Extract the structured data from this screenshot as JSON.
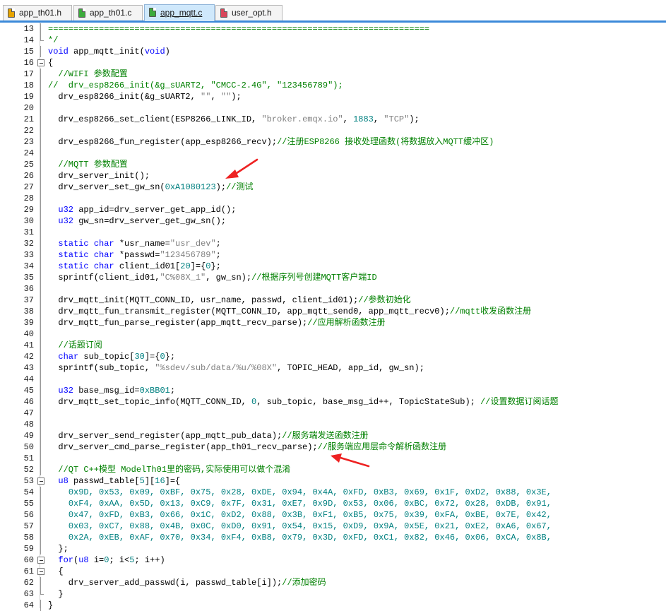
{
  "tabs": [
    {
      "label": "app_th01.h",
      "color": "#e6a400",
      "active": false
    },
    {
      "label": "app_th01.c",
      "color": "#3cab3c",
      "active": false
    },
    {
      "label": "app_mqtt.c",
      "color": "#3cab3c",
      "active": true
    },
    {
      "label": "user_opt.h",
      "color": "#d8465a",
      "active": false
    }
  ],
  "lines": [
    {
      "n": "13",
      "segs": [
        {
          "t": "===========================================================================",
          "c": "cm"
        }
      ]
    },
    {
      "n": "14",
      "segs": [
        {
          "t": "*/",
          "c": "cm"
        }
      ]
    },
    {
      "n": "15",
      "segs": [
        {
          "t": "void",
          "c": "kw"
        },
        {
          "t": " app_mqtt_init(",
          "c": ""
        },
        {
          "t": "void",
          "c": "kw"
        },
        {
          "t": ")",
          "c": ""
        }
      ]
    },
    {
      "n": "16",
      "segs": [
        {
          "t": "{",
          "c": ""
        }
      ]
    },
    {
      "n": "17",
      "segs": [
        {
          "t": "  //WIFI 参数配置",
          "c": "cm"
        }
      ]
    },
    {
      "n": "18",
      "segs": [
        {
          "t": "//  drv_esp8266_init(&g_sUART2, \"CMCC-2.4G\", \"123456789\");",
          "c": "cm"
        }
      ]
    },
    {
      "n": "19",
      "segs": [
        {
          "t": "  drv_esp8266_init(&g_sUART2, ",
          "c": ""
        },
        {
          "t": "\"\"",
          "c": "st"
        },
        {
          "t": ", ",
          "c": ""
        },
        {
          "t": "\"\"",
          "c": "st"
        },
        {
          "t": ");",
          "c": ""
        }
      ]
    },
    {
      "n": "20",
      "segs": []
    },
    {
      "n": "21",
      "segs": [
        {
          "t": "  drv_esp8266_set_client(ESP8266_LINK_ID, ",
          "c": ""
        },
        {
          "t": "\"broker.emqx.io\"",
          "c": "st"
        },
        {
          "t": ", ",
          "c": ""
        },
        {
          "t": "1883",
          "c": "nm"
        },
        {
          "t": ", ",
          "c": ""
        },
        {
          "t": "\"TCP\"",
          "c": "st"
        },
        {
          "t": ");",
          "c": ""
        }
      ]
    },
    {
      "n": "22",
      "segs": []
    },
    {
      "n": "23",
      "segs": [
        {
          "t": "  drv_esp8266_fun_register(app_esp8266_recv);",
          "c": ""
        },
        {
          "t": "//注册ESP8266 接收处理函数(将数据放入MQTT缓冲区)",
          "c": "cm"
        }
      ]
    },
    {
      "n": "24",
      "segs": []
    },
    {
      "n": "25",
      "segs": [
        {
          "t": "  //MQTT 参数配置",
          "c": "cm"
        }
      ]
    },
    {
      "n": "26",
      "segs": [
        {
          "t": "  drv_server_init();",
          "c": ""
        }
      ]
    },
    {
      "n": "27",
      "segs": [
        {
          "t": "  drv_server_set_gw_sn(",
          "c": ""
        },
        {
          "t": "0xA1080123",
          "c": "nm"
        },
        {
          "t": ");",
          "c": ""
        },
        {
          "t": "//测试",
          "c": "cm"
        }
      ]
    },
    {
      "n": "28",
      "segs": []
    },
    {
      "n": "29",
      "segs": [
        {
          "t": "  ",
          "c": ""
        },
        {
          "t": "u32",
          "c": "kw"
        },
        {
          "t": " app_id=drv_server_get_app_id();",
          "c": ""
        }
      ]
    },
    {
      "n": "30",
      "segs": [
        {
          "t": "  ",
          "c": ""
        },
        {
          "t": "u32",
          "c": "kw"
        },
        {
          "t": " gw_sn=drv_server_get_gw_sn();",
          "c": ""
        }
      ]
    },
    {
      "n": "31",
      "segs": []
    },
    {
      "n": "32",
      "segs": [
        {
          "t": "  ",
          "c": ""
        },
        {
          "t": "static",
          "c": "kw"
        },
        {
          "t": " ",
          "c": ""
        },
        {
          "t": "char",
          "c": "kw"
        },
        {
          "t": " *usr_name=",
          "c": ""
        },
        {
          "t": "\"usr_dev\"",
          "c": "st"
        },
        {
          "t": ";",
          "c": ""
        }
      ]
    },
    {
      "n": "33",
      "segs": [
        {
          "t": "  ",
          "c": ""
        },
        {
          "t": "static",
          "c": "kw"
        },
        {
          "t": " ",
          "c": ""
        },
        {
          "t": "char",
          "c": "kw"
        },
        {
          "t": " *passwd=",
          "c": ""
        },
        {
          "t": "\"123456789\"",
          "c": "st"
        },
        {
          "t": ";",
          "c": ""
        }
      ]
    },
    {
      "n": "34",
      "segs": [
        {
          "t": "  ",
          "c": ""
        },
        {
          "t": "static",
          "c": "kw"
        },
        {
          "t": " ",
          "c": ""
        },
        {
          "t": "char",
          "c": "kw"
        },
        {
          "t": " client_id01[",
          "c": ""
        },
        {
          "t": "20",
          "c": "nm"
        },
        {
          "t": "]={",
          "c": ""
        },
        {
          "t": "0",
          "c": "nm"
        },
        {
          "t": "};",
          "c": ""
        }
      ]
    },
    {
      "n": "35",
      "segs": [
        {
          "t": "  sprintf(client_id01,",
          "c": ""
        },
        {
          "t": "\"C%08X_1\"",
          "c": "st"
        },
        {
          "t": ", gw_sn);",
          "c": ""
        },
        {
          "t": "//根据序列号创建MQTT客户端ID",
          "c": "cm"
        }
      ]
    },
    {
      "n": "36",
      "segs": []
    },
    {
      "n": "37",
      "segs": [
        {
          "t": "  drv_mqtt_init(MQTT_CONN_ID, usr_name, passwd, client_id01);",
          "c": ""
        },
        {
          "t": "//参数初始化",
          "c": "cm"
        }
      ]
    },
    {
      "n": "38",
      "segs": [
        {
          "t": "  drv_mqtt_fun_transmit_register(MQTT_CONN_ID, app_mqtt_send0, app_mqtt_recv0);",
          "c": ""
        },
        {
          "t": "//mqtt收发函数注册",
          "c": "cm"
        }
      ]
    },
    {
      "n": "39",
      "segs": [
        {
          "t": "  drv_mqtt_fun_parse_register(app_mqtt_recv_parse);",
          "c": ""
        },
        {
          "t": "//应用解析函数注册",
          "c": "cm"
        }
      ]
    },
    {
      "n": "40",
      "segs": []
    },
    {
      "n": "41",
      "segs": [
        {
          "t": "  //话题订阅",
          "c": "cm"
        }
      ]
    },
    {
      "n": "42",
      "segs": [
        {
          "t": "  ",
          "c": ""
        },
        {
          "t": "char",
          "c": "kw"
        },
        {
          "t": " sub_topic[",
          "c": ""
        },
        {
          "t": "30",
          "c": "nm"
        },
        {
          "t": "]={",
          "c": ""
        },
        {
          "t": "0",
          "c": "nm"
        },
        {
          "t": "};",
          "c": ""
        }
      ]
    },
    {
      "n": "43",
      "segs": [
        {
          "t": "  sprintf(sub_topic, ",
          "c": ""
        },
        {
          "t": "\"%sdev/sub/data/%u/%08X\"",
          "c": "st"
        },
        {
          "t": ", TOPIC_HEAD, app_id, gw_sn);",
          "c": ""
        }
      ]
    },
    {
      "n": "44",
      "segs": []
    },
    {
      "n": "45",
      "segs": [
        {
          "t": "  ",
          "c": ""
        },
        {
          "t": "u32",
          "c": "kw"
        },
        {
          "t": " base_msg_id=",
          "c": ""
        },
        {
          "t": "0xBB01",
          "c": "nm"
        },
        {
          "t": ";",
          "c": ""
        }
      ]
    },
    {
      "n": "46",
      "segs": [
        {
          "t": "  drv_mqtt_set_topic_info(MQTT_CONN_ID, ",
          "c": ""
        },
        {
          "t": "0",
          "c": "nm"
        },
        {
          "t": ", sub_topic, base_msg_id++, TopicStateSub); ",
          "c": ""
        },
        {
          "t": "//设置数据订阅话题",
          "c": "cm"
        }
      ]
    },
    {
      "n": "47",
      "segs": []
    },
    {
      "n": "48",
      "segs": []
    },
    {
      "n": "49",
      "segs": [
        {
          "t": "  drv_server_send_register(app_mqtt_pub_data);",
          "c": ""
        },
        {
          "t": "//服务端发送函数注册",
          "c": "cm"
        }
      ]
    },
    {
      "n": "50",
      "segs": [
        {
          "t": "  drv_server_cmd_parse_register(app_th01_recv_parse);",
          "c": ""
        },
        {
          "t": "//服务端应用层命令解析函数注册",
          "c": "cm"
        }
      ]
    },
    {
      "n": "51",
      "segs": []
    },
    {
      "n": "52",
      "segs": [
        {
          "t": "  //QT C++模型 ModelTh01里的密码,实际使用可以做个混淆",
          "c": "cm"
        }
      ]
    },
    {
      "n": "53",
      "segs": [
        {
          "t": "  ",
          "c": ""
        },
        {
          "t": "u8",
          "c": "kw"
        },
        {
          "t": " passwd_table[",
          "c": ""
        },
        {
          "t": "5",
          "c": "nm"
        },
        {
          "t": "][",
          "c": ""
        },
        {
          "t": "16",
          "c": "nm"
        },
        {
          "t": "]={",
          "c": ""
        }
      ]
    },
    {
      "n": "54",
      "segs": [
        {
          "t": "    ",
          "c": ""
        },
        {
          "t": "0x9D, 0x53, 0x09, 0xBF, 0x75, 0x28, 0xDE, 0x94, 0x4A, 0xFD, 0xB3, 0x69, 0x1F, 0xD2, 0x88, 0x3E,",
          "c": "nm"
        }
      ]
    },
    {
      "n": "55",
      "segs": [
        {
          "t": "    ",
          "c": ""
        },
        {
          "t": "0xF4, 0xAA, 0x5D, 0x13, 0xC9, 0x7F, 0x31, 0xE7, 0x9D, 0x53, 0x06, 0xBC, 0x72, 0x28, 0xDB, 0x91,",
          "c": "nm"
        }
      ]
    },
    {
      "n": "56",
      "segs": [
        {
          "t": "    ",
          "c": ""
        },
        {
          "t": "0x47, 0xFD, 0xB3, 0x66, 0x1C, 0xD2, 0x88, 0x3B, 0xF1, 0xB5, 0x75, 0x39, 0xFA, 0xBE, 0x7E, 0x42,",
          "c": "nm"
        }
      ]
    },
    {
      "n": "57",
      "segs": [
        {
          "t": "    ",
          "c": ""
        },
        {
          "t": "0x03, 0xC7, 0x88, 0x4B, 0x0C, 0xD0, 0x91, 0x54, 0x15, 0xD9, 0x9A, 0x5E, 0x21, 0xE2, 0xA6, 0x67,",
          "c": "nm"
        }
      ]
    },
    {
      "n": "58",
      "segs": [
        {
          "t": "    ",
          "c": ""
        },
        {
          "t": "0x2A, 0xEB, 0xAF, 0x70, 0x34, 0xF4, 0xB8, 0x79, 0x3D, 0xFD, 0xC1, 0x82, 0x46, 0x06, 0xCA, 0x8B,",
          "c": "nm"
        }
      ]
    },
    {
      "n": "59",
      "segs": [
        {
          "t": "  };",
          "c": ""
        }
      ]
    },
    {
      "n": "60",
      "segs": [
        {
          "t": "  ",
          "c": ""
        },
        {
          "t": "for",
          "c": "kw"
        },
        {
          "t": "(",
          "c": ""
        },
        {
          "t": "u8",
          "c": "kw"
        },
        {
          "t": " i=",
          "c": ""
        },
        {
          "t": "0",
          "c": "nm"
        },
        {
          "t": "; i<",
          "c": ""
        },
        {
          "t": "5",
          "c": "nm"
        },
        {
          "t": "; i++)",
          "c": ""
        }
      ]
    },
    {
      "n": "61",
      "segs": [
        {
          "t": "  {",
          "c": ""
        }
      ]
    },
    {
      "n": "62",
      "segs": [
        {
          "t": "    drv_server_add_passwd(i, passwd_table[i]);",
          "c": ""
        },
        {
          "t": "//添加密码",
          "c": "cm"
        }
      ]
    },
    {
      "n": "63",
      "segs": [
        {
          "t": "  }",
          "c": ""
        }
      ]
    },
    {
      "n": "64",
      "segs": [
        {
          "t": "}",
          "c": ""
        }
      ]
    }
  ],
  "colors": {
    "keyword": "#0000ff",
    "comment": "#008000",
    "string": "#808080",
    "number": "#008080",
    "arrow": "#ee2222",
    "tab_active": "#cfe8fb",
    "tab_underline": "#3b89d9"
  }
}
